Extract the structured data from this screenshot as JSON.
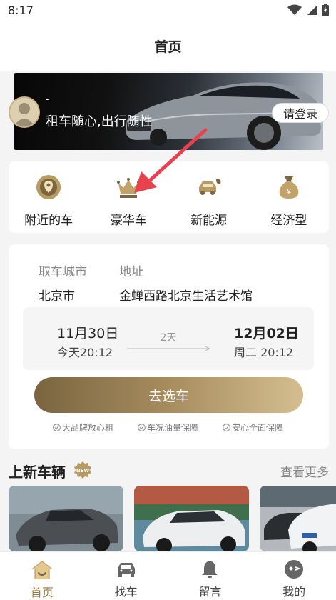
{
  "status_bar": {
    "time": "8:17"
  },
  "header": {
    "title": "首页"
  },
  "banner": {
    "user_name": "-",
    "slogan": "租车随心,出行随性",
    "login_label": "请登录"
  },
  "categories": [
    {
      "label": "附近的车",
      "icon": "location-pin-icon"
    },
    {
      "label": "豪华车",
      "icon": "crown-icon"
    },
    {
      "label": "新能源",
      "icon": "ev-car-icon"
    },
    {
      "label": "经济型",
      "icon": "money-bag-icon"
    }
  ],
  "booking": {
    "city_label": "取车城市",
    "address_label": "地址",
    "city": "北京市",
    "address": "金蝉西路北京生活艺术馆",
    "pickup_date": "11月30日",
    "pickup_time": "今天20:12",
    "duration": "2天",
    "return_date": "12月02日",
    "return_time": "周二 20:12",
    "cta_label": "去选车",
    "guarantees": [
      "大品牌放心租",
      "车况油量保障",
      "安心全面保障"
    ]
  },
  "new_vehicles": {
    "title": "上新车辆",
    "badge": "NEW",
    "more_label": "查看更多"
  },
  "tabbar": [
    {
      "label": "首页",
      "icon": "home-icon",
      "active": true
    },
    {
      "label": "找车",
      "icon": "car-icon",
      "active": false
    },
    {
      "label": "留言",
      "icon": "bell-icon",
      "active": false
    },
    {
      "label": "我的",
      "icon": "profile-icon",
      "active": false
    }
  ],
  "colors": {
    "accent": "#9a7b43",
    "cta_start": "#7a6540",
    "cta_end": "#d4be90",
    "annotation_arrow": "#e8424f"
  }
}
